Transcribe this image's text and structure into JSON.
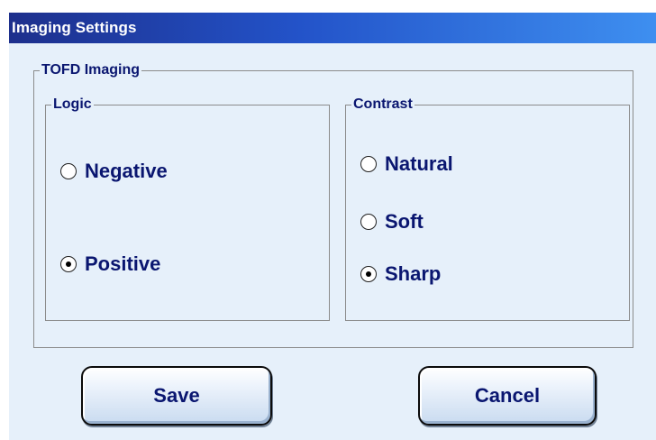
{
  "window": {
    "title": "Imaging Settings",
    "title_bar_colors": [
      "#1d2f8c",
      "#3e8ff0"
    ],
    "background_color": "#e6f0fa",
    "text_color": "#0a1670"
  },
  "tofd_group": {
    "label": "TOFD Imaging",
    "logic": {
      "label": "Logic",
      "options": [
        {
          "label": "Negative",
          "selected": false
        },
        {
          "label": "Positive",
          "selected": true
        }
      ]
    },
    "contrast": {
      "label": "Contrast",
      "options": [
        {
          "label": "Natural",
          "selected": false
        },
        {
          "label": "Soft",
          "selected": false
        },
        {
          "label": "Sharp",
          "selected": true
        }
      ]
    }
  },
  "buttons": {
    "save_label": "Save",
    "cancel_label": "Cancel"
  }
}
